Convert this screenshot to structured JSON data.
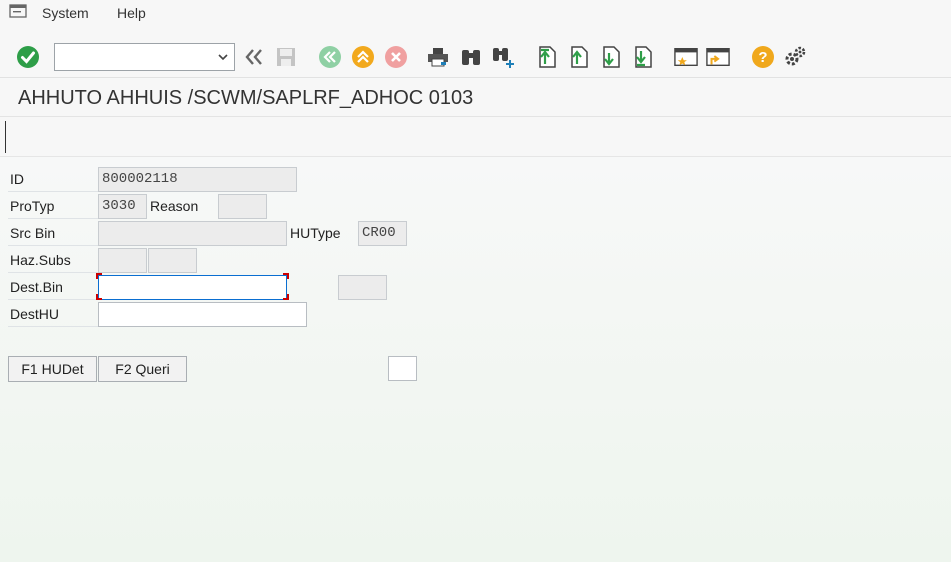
{
  "menu": {
    "items": [
      {
        "label": "System"
      },
      {
        "label": "Help"
      }
    ]
  },
  "toolbar": {
    "command_field": {
      "value": "",
      "placeholder": ""
    },
    "icons": [
      "enter-checkmark-icon",
      "back-double-arrow-icon",
      "save-icon",
      "back-icon",
      "exit-icon",
      "cancel-icon",
      "print-icon",
      "find-icon",
      "find-next-icon",
      "first-page-icon",
      "previous-page-icon",
      "next-page-icon",
      "last-page-icon",
      "create-session-icon",
      "shortcut-icon",
      "help-icon",
      "customize-layout-icon"
    ]
  },
  "title": "AHHUTO AHHUIS /SCWM/SAPLRF_ADHOC 0103",
  "form": {
    "id": {
      "label": "ID",
      "value": "800002118"
    },
    "protyp": {
      "label": "ProTyp",
      "value": "3030"
    },
    "reason": {
      "label": "Reason",
      "value": ""
    },
    "src_bin": {
      "label": "Src Bin",
      "value": ""
    },
    "hutype": {
      "label": "HUType",
      "value": "CR00"
    },
    "haz_subs": {
      "label": "Haz.Subs",
      "value1": "",
      "value2": ""
    },
    "dest_bin": {
      "label": "Dest.Bin",
      "value": "",
      "extra": ""
    },
    "dest_hu": {
      "label": "DestHU",
      "value": ""
    }
  },
  "fkeys": [
    {
      "label": "F1 HUDet"
    },
    {
      "label": "F2 Queri"
    }
  ],
  "colors": {
    "enter_green": "#2e9e48",
    "nav_green_disabled": "#8fd0a4",
    "exit_orange": "#f2a91d",
    "cancel_red_disabled": "#f0a0a0",
    "help_orange": "#f0a81c",
    "focus_blue": "#0a6ed1"
  }
}
